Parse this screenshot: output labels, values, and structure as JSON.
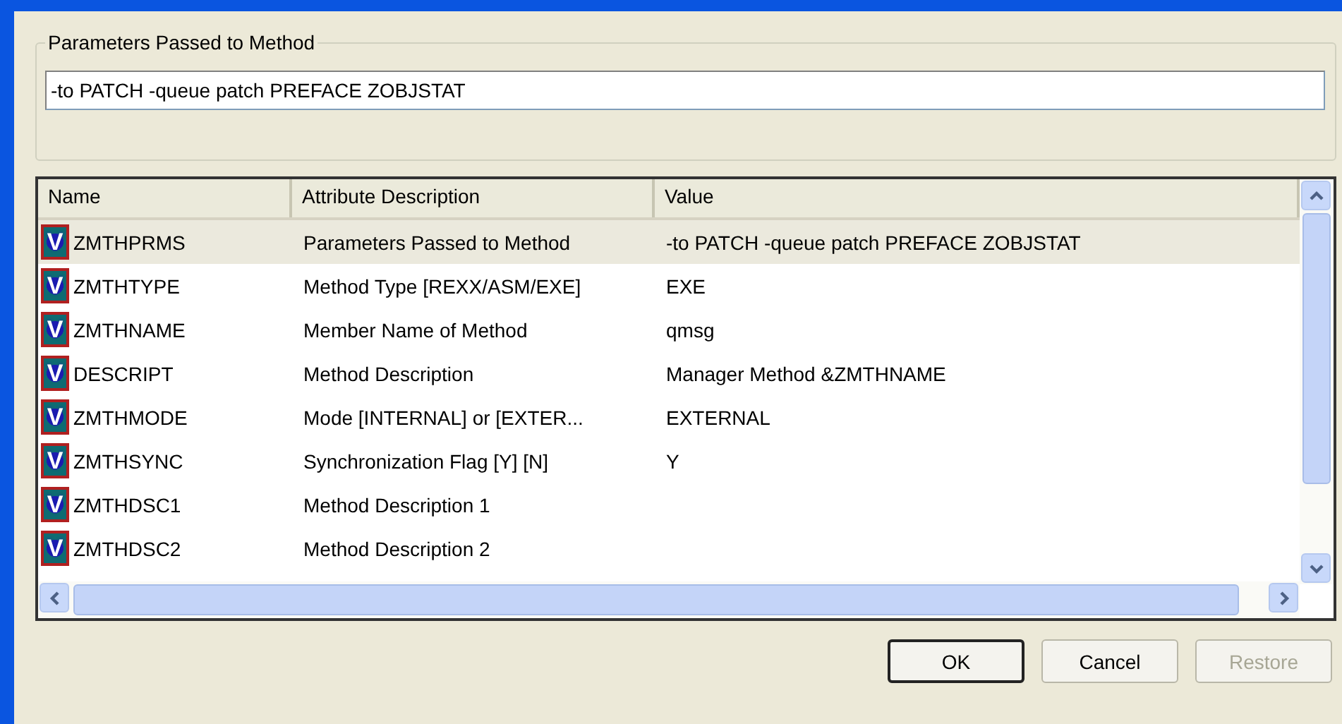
{
  "group": {
    "title": "Parameters Passed to Method",
    "value": "-to PATCH -queue patch PREFACE ZOBJSTAT"
  },
  "table": {
    "columns": [
      "Name",
      "Attribute Description",
      "Value"
    ],
    "rows": [
      {
        "name": "ZMTHPRMS",
        "description": "Parameters Passed to Method",
        "value": "-to PATCH -queue patch PREFACE ZOBJSTAT",
        "selected": true,
        "icon": "V"
      },
      {
        "name": "ZMTHTYPE",
        "description": "Method Type [REXX/ASM/EXE]",
        "value": "EXE",
        "selected": false,
        "icon": "V"
      },
      {
        "name": "ZMTHNAME",
        "description": "Member Name of Method",
        "value": "qmsg",
        "selected": false,
        "icon": "V"
      },
      {
        "name": "DESCRIPT",
        "description": "Method Description",
        "value": "Manager Method &ZMTHNAME",
        "selected": false,
        "icon": "V"
      },
      {
        "name": "ZMTHMODE",
        "description": "Mode [INTERNAL] or [EXTER...",
        "value": "EXTERNAL",
        "selected": false,
        "icon": "V"
      },
      {
        "name": "ZMTHSYNC",
        "description": "Synchronization Flag [Y] [N]",
        "value": "Y",
        "selected": false,
        "icon": "V"
      },
      {
        "name": "ZMTHDSC1",
        "description": "Method Description 1",
        "selected": false,
        "icon": "V"
      },
      {
        "name": "ZMTHDSC2",
        "description": "Method Description 2",
        "selected": false,
        "icon": "V"
      }
    ]
  },
  "buttons": [
    {
      "label": "OK",
      "default": true,
      "disabled": false
    },
    {
      "label": "Cancel",
      "default": false,
      "disabled": false
    },
    {
      "label": "Restore",
      "default": false,
      "disabled": true
    }
  ]
}
